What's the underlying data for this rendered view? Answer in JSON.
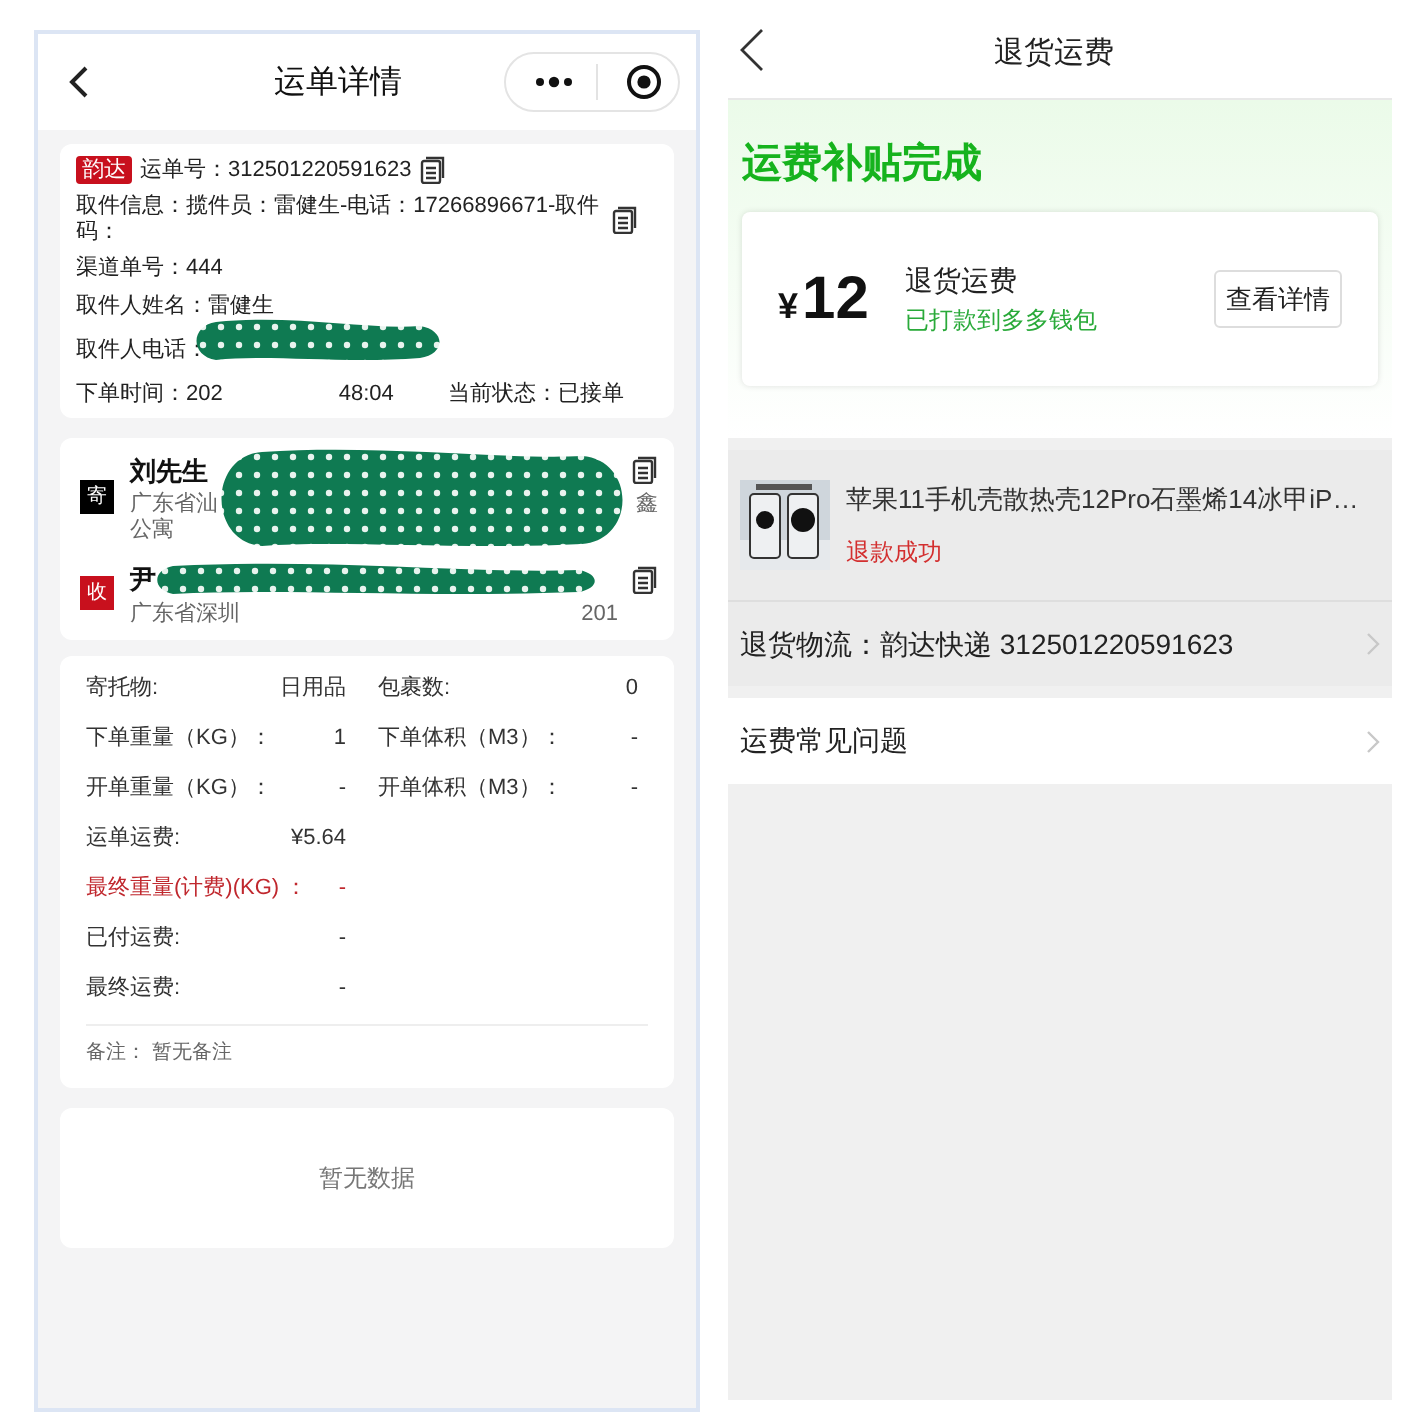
{
  "left": {
    "title": "运单详情",
    "waybill": {
      "carrier": "韵达",
      "text": "运单号：312501220591623"
    },
    "info_lines": [
      "取件信息：揽件员：雷健生-电话：17266896671-取件码：",
      "渠道单号：444",
      "取件人姓名：雷健生",
      "取件人电话："
    ],
    "order_time": [
      "下单时间：202",
      "48:04"
    ],
    "status": "当前状态：已接单",
    "parties": [
      {
        "kind": "sender",
        "badge": "寄",
        "name": "刘先生",
        "address": [
          "广东省汕",
          "鑫",
          "公寓"
        ]
      },
      {
        "kind": "receiver",
        "badge": "收",
        "name": "尹",
        "address": [
          "广东省深圳",
          "201"
        ]
      }
    ],
    "details": [
      [
        {
          "label": "寄托物:",
          "value": "日用品",
          "highlight": false
        },
        {
          "label": "包裹数:",
          "value": "0",
          "highlight": false
        }
      ],
      [
        {
          "label": "下单重量（KG）：",
          "value": "1",
          "highlight": false
        },
        {
          "label": "下单体积（M3）：",
          "value": "-",
          "highlight": false
        }
      ],
      [
        {
          "label": "开单重量（KG）：",
          "value": "-",
          "highlight": false
        },
        {
          "label": "开单体积（M3）：",
          "value": "-",
          "highlight": false
        }
      ],
      [
        {
          "label": "运单运费:",
          "value": "¥5.64",
          "highlight": false
        }
      ],
      [
        {
          "label": "最终重量(计费)(KG) ：",
          "value": "-",
          "highlight": true
        }
      ],
      [
        {
          "label": "已付运费:",
          "value": "-",
          "highlight": false
        }
      ],
      [
        {
          "label": "最终运费:",
          "value": "-",
          "highlight": false
        }
      ]
    ],
    "note": "备注：  暂无备注",
    "empty": "暂无数据"
  },
  "right": {
    "title": "退货运费",
    "banner": "运费补贴完成",
    "refund": {
      "currency": "¥",
      "amount": "12",
      "label": "退货运费",
      "sub": "已打款到多多钱包",
      "button": "查看详情"
    },
    "product": {
      "kind": "picture",
      "title": "苹果11手机壳散热壳12Pro石墨烯14冰甲iP…",
      "status": "退款成功"
    },
    "logistics": "退货物流：韵达快递 312501220591623",
    "faq": "运费常见问题"
  }
}
